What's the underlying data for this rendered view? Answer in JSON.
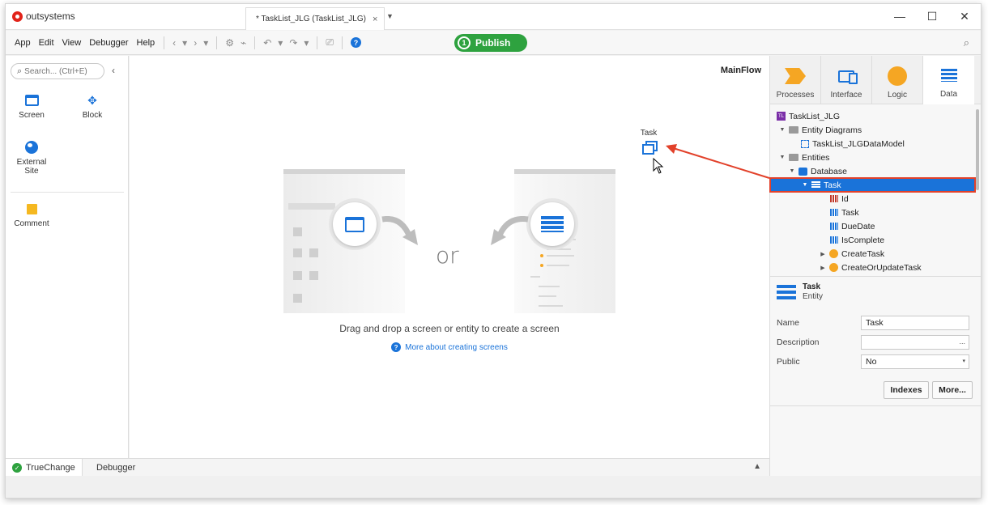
{
  "app": {
    "logo_text": "outsystems",
    "tab_title": "* TaskList_JLG (TaskList_JLG)",
    "tab_close": "×",
    "tab_dropdown": "▼",
    "window_controls": {
      "minimize": "—",
      "maximize": "☐",
      "close": "✕"
    }
  },
  "menu": {
    "items": [
      "App",
      "Edit",
      "View",
      "Debugger",
      "Help"
    ],
    "toolbar_glyphs": {
      "back": "‹",
      "dropdown": "▾",
      "forward": "›",
      "settings": "⚙",
      "plug": "⌁",
      "undo": "↶",
      "redo": "↷",
      "compare": "⎚",
      "help": "?"
    },
    "publish_step": "1",
    "publish_label": "Publish",
    "search_glyph": "⌕"
  },
  "left_panel": {
    "search_placeholder": "Search... (Ctrl+E)",
    "search_glyph": "⌕",
    "collapse_glyph": "‹",
    "widgets": {
      "screen": "Screen",
      "block": "Block",
      "external_site_line1": "External",
      "external_site_line2": "Site",
      "comment": "Comment"
    },
    "block_glyph": "✥"
  },
  "canvas": {
    "flow_name": "MainFlow",
    "dragged_entity": "Task",
    "or_text": "or",
    "drag_text": "Drag and drop a screen or entity to create a screen",
    "help_glyph": "?",
    "more_link": "More about creating screens"
  },
  "bottom": {
    "tabs": [
      "TrueChange",
      "Debugger"
    ],
    "truechange_check": "✓",
    "caret": "▲"
  },
  "right_panel": {
    "tabs": [
      "Processes",
      "Interface",
      "Logic",
      "Data"
    ],
    "active_tab": "Data",
    "tree": {
      "module_badge": "TL",
      "module": "TaskList_JLG",
      "entity_diagrams": "Entity Diagrams",
      "data_model": "TaskList_JLGDataModel",
      "entities": "Entities",
      "database": "Database",
      "selected_entity": "Task",
      "attributes": [
        "Id",
        "Task",
        "DueDate",
        "IsComplete"
      ],
      "actions": [
        "CreateTask",
        "CreateOrUpdateTask"
      ],
      "expanded_glyph": "▼",
      "collapsed_glyph": "▶"
    },
    "properties": {
      "entity_name": "Task",
      "entity_type": "Entity",
      "name_label": "Name",
      "name_value": "Task",
      "description_label": "Description",
      "description_value": "",
      "description_more": "...",
      "public_label": "Public",
      "public_value": "No",
      "public_dropdown": "▾",
      "indexes_button": "Indexes",
      "more_button": "More..."
    }
  },
  "colors": {
    "accent_blue": "#1a73d9",
    "publish_green": "#2ea23f",
    "highlight_red": "#e2412a",
    "logo_red": "#e2231a",
    "orange": "#f5a623"
  }
}
